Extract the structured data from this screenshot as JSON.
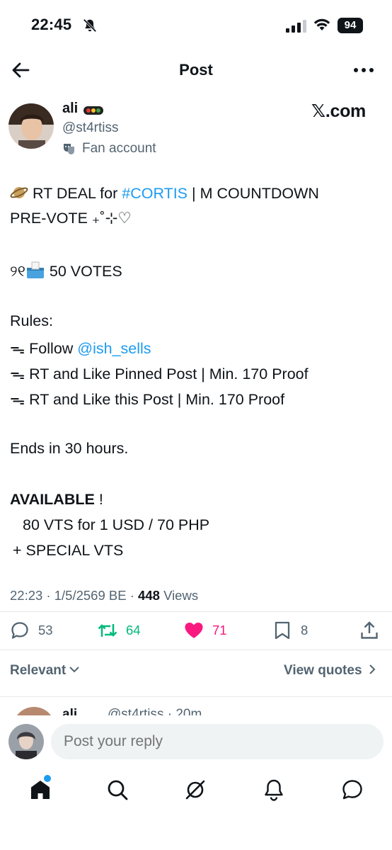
{
  "status_bar": {
    "time": "22:45",
    "battery": "94"
  },
  "header": {
    "title": "Post"
  },
  "author": {
    "name": "ali",
    "handle": "@st4rtiss",
    "label": "Fan account",
    "source": "𝕏.com"
  },
  "post": {
    "line1_a": " RT DEAL for ",
    "line1_hashtag": "#CORTIS",
    "line1_b": "  |  M COUNTDOWN",
    "line2": "PRE-VOTE ₊˚⊹♡",
    "line3_prefix": "୨୧",
    "line3_text": " 50 VOTES",
    "rules_title": "Rules:",
    "rule1_a": "ᯓ Follow ",
    "rule1_mention": "@ish_sells",
    "rule2": "ᯓ RT and Like Pinned Post | Min. 170 Proof",
    "rule3": "ᯓ RT and Like this Post | Min. 170 Proof",
    "ends": "Ends in 30 hours.",
    "available_title": "AVAILABLE",
    "available_bang": " !",
    "offer1": "80 VTS for 1 USD / 70 PHP",
    "offer2": "+ SPECIAL VTS"
  },
  "meta": {
    "time": "22:23",
    "date": "1/5/2569 BE",
    "views_count": "448",
    "views_label": "Views"
  },
  "actions": {
    "replies": "53",
    "reposts": "64",
    "likes": "71",
    "bookmarks": "8"
  },
  "colors": {
    "accent": "#1d9bf0",
    "repost": "#00ba7c",
    "like": "#f91880",
    "muted": "#536471"
  },
  "filters": {
    "sort": "Relevant",
    "quotes": "View quotes"
  },
  "reply_peek": {
    "name": "ali",
    "handle": "@st4rtiss · 20m"
  },
  "composer": {
    "placeholder": "Post your reply"
  },
  "icons": [
    "back-arrow-icon",
    "more-icon",
    "bell-off-icon",
    "reply-icon",
    "repost-icon",
    "heart-icon",
    "bookmark-icon",
    "share-icon",
    "home-icon",
    "search-icon",
    "grok-icon",
    "notifications-icon",
    "messages-icon"
  ]
}
